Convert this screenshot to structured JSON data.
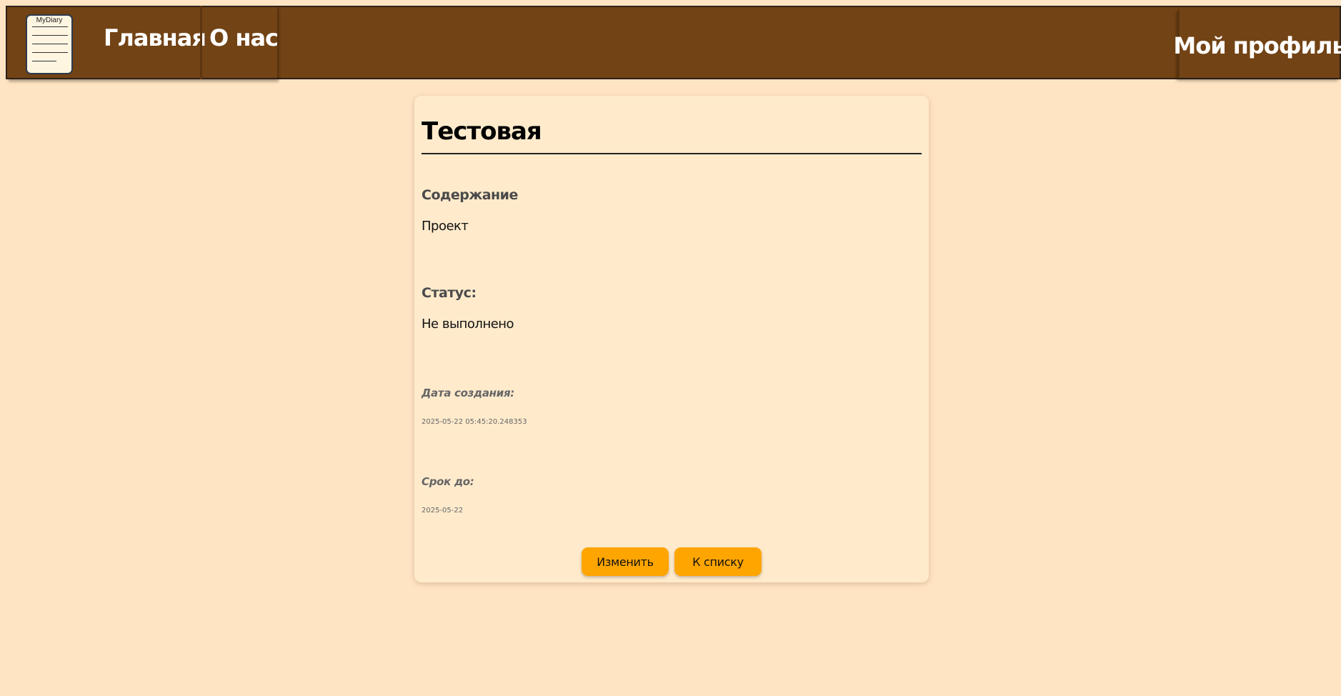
{
  "nav": {
    "logo_text": "MyDiary",
    "home_label": "Главная",
    "about_label": "О нас",
    "profile_label": "Мой профиль"
  },
  "task": {
    "title": "Тестовая",
    "content_label": "Содержание",
    "content_value": "Проект",
    "status_label": "Статус:",
    "status_value": "Не выполнено",
    "created_label": "Дата создания:",
    "created_value": "2025-05-22 05:45:20.248353",
    "deadline_label": "Срок до:",
    "deadline_value": "2025-05-22"
  },
  "actions": {
    "edit_label": "Изменить",
    "back_label": "К списку"
  },
  "colors": {
    "page_background": "#ffe4c3",
    "navbar": "#724315",
    "card": "#ffebcc",
    "button": "#ffa500"
  }
}
